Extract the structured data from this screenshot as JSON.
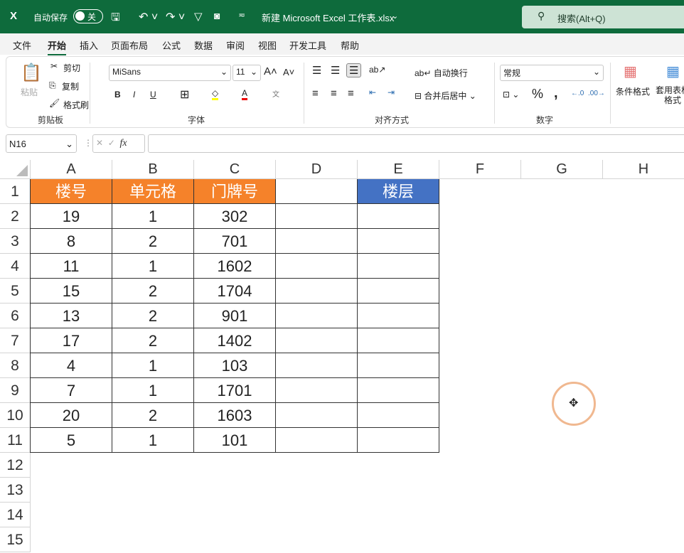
{
  "titlebar": {
    "autosave_label": "自动保存",
    "autosave_state": "关",
    "filename": "新建 Microsoft Excel 工作表.xlsx",
    "search_placeholder": "搜索(Alt+Q)"
  },
  "menu": [
    "文件",
    "开始",
    "插入",
    "页面布局",
    "公式",
    "数据",
    "审阅",
    "视图",
    "开发工具",
    "帮助"
  ],
  "ribbon": {
    "clipboard": {
      "paste": "粘贴",
      "cut": "剪切",
      "copy": "复制",
      "format_painter": "格式刷",
      "group": "剪贴板"
    },
    "font": {
      "name": "MiSans",
      "size": "11",
      "group": "字体",
      "bold": "B",
      "italic": "I",
      "underline": "U"
    },
    "alignment": {
      "wrap": "自动换行",
      "merge": "合并后居中",
      "group": "对齐方式"
    },
    "number": {
      "format": "常规",
      "group": "数字"
    },
    "styles": {
      "conditional": "条件格式",
      "table": "套用表格格式"
    }
  },
  "formula_bar": {
    "name_box": "N16",
    "fx": "fx",
    "value": ""
  },
  "columns": [
    "A",
    "B",
    "C",
    "D",
    "E",
    "F",
    "G",
    "H"
  ],
  "rows": [
    "1",
    "2",
    "3",
    "4",
    "5",
    "6",
    "7",
    "8",
    "9",
    "10",
    "11",
    "12",
    "13",
    "14",
    "15"
  ],
  "table": {
    "headers": [
      "楼号",
      "单元格",
      "门牌号",
      "",
      "楼层"
    ],
    "data": [
      [
        "19",
        "1",
        "302"
      ],
      [
        "8",
        "2",
        "701"
      ],
      [
        "11",
        "1",
        "1602"
      ],
      [
        "15",
        "2",
        "1704"
      ],
      [
        "13",
        "2",
        "901"
      ],
      [
        "17",
        "2",
        "1402"
      ],
      [
        "4",
        "1",
        "103"
      ],
      [
        "7",
        "1",
        "1701"
      ],
      [
        "20",
        "2",
        "1603"
      ],
      [
        "5",
        "1",
        "101"
      ]
    ]
  },
  "colors": {
    "title_bar": "#0e6b3c",
    "header_orange": "#f5822a",
    "header_blue": "#4472c4"
  }
}
